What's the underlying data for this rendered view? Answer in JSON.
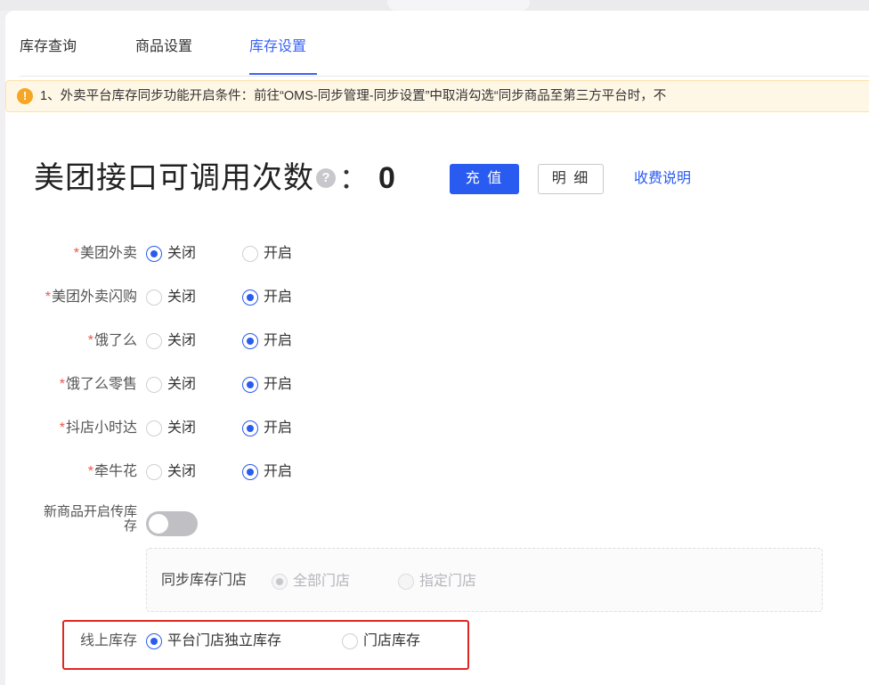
{
  "tabs": [
    {
      "label": "库存查询",
      "active": false
    },
    {
      "label": "商品设置",
      "active": false
    },
    {
      "label": "库存设置",
      "active": true
    }
  ],
  "alert": {
    "icon": "warning-icon",
    "text": "1、外卖平台库存同步功能开启条件：前往“OMS-同步管理-同步设置”中取消勾选“同步商品至第三方平台时，不"
  },
  "quota": {
    "title": "美团接口可调用次数",
    "colon": "：",
    "count": "0",
    "help_icon": "?",
    "recharge_label": "充 值",
    "detail_label": "明 细",
    "fee_link": "收费说明"
  },
  "platforms": [
    {
      "label": "美团外卖",
      "required": true,
      "selected": "关闭"
    },
    {
      "label": "美团外卖闪购",
      "required": true,
      "selected": "开启"
    },
    {
      "label": "饿了么",
      "required": true,
      "selected": "开启"
    },
    {
      "label": "饿了么零售",
      "required": true,
      "selected": "开启"
    },
    {
      "label": "抖店小时达",
      "required": true,
      "selected": "开启"
    },
    {
      "label": "牵牛花",
      "required": true,
      "selected": "开启"
    }
  ],
  "options": {
    "off": "关闭",
    "on": "开启"
  },
  "new_product_toggle": {
    "label": "新商品开启传库存",
    "enabled": false
  },
  "sync_store": {
    "label": "同步库存门店",
    "options": [
      "全部门店",
      "指定门店"
    ],
    "selected": "全部门店",
    "disabled": true
  },
  "online_stock": {
    "label": "线上库存",
    "options": [
      "平台门店独立库存",
      "门店库存"
    ],
    "selected": "平台门店独立库存"
  },
  "colors": {
    "accent": "#2a5bf0",
    "required": "#e8574a",
    "highlight": "#e0271f",
    "alert_bg": "#fff7e6"
  }
}
